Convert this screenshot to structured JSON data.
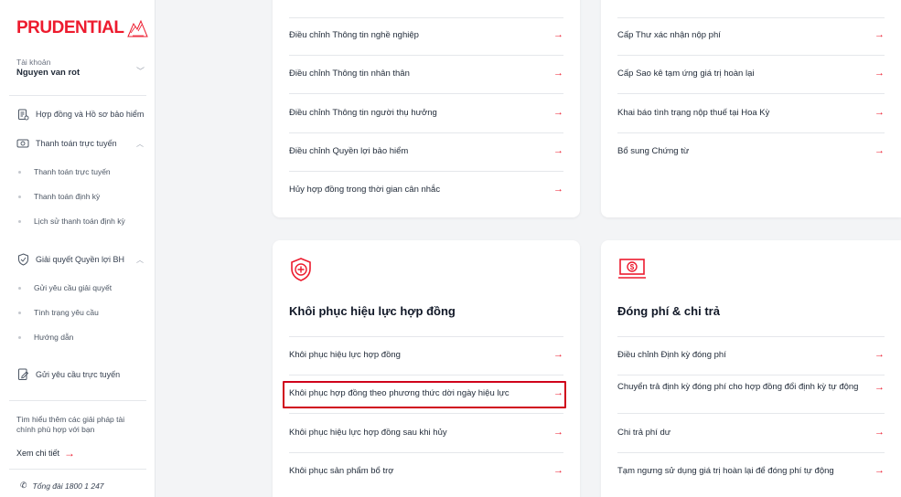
{
  "brand": {
    "logo_text": "PRUDENTIAL",
    "accent": "#ed1b2e"
  },
  "account": {
    "label": "Tài khoản",
    "name": "Nguyen van rot"
  },
  "nav": {
    "contracts": "Hợp đồng và Hồ sơ bảo hiểm",
    "online_payment": "Thanh toán trực tuyến",
    "online_payment_sub": [
      "Thanh toán trực tuyến",
      "Thanh toán định kỳ",
      "Lịch sử thanh toán định kỳ"
    ],
    "claims": "Giải quyết Quyền lợi BH",
    "claims_sub": [
      "Gửi yêu cầu giải quyết",
      "Tình trạng yêu cầu",
      "Hướng dẫn"
    ],
    "online_request": "Gửi yêu cầu trực tuyến"
  },
  "promo": {
    "text": "Tìm hiểu thêm các giải pháp tài chính phù hợp với bạn",
    "more": "Xem chi tiết"
  },
  "hotline": "Tổng đài 1800 1 247",
  "card_top_left": {
    "items": [
      "Điều chỉnh Thông tin nghề nghiệp",
      "Điều chỉnh Thông tin nhân thân",
      "Điều chỉnh Thông tin người thụ hưởng",
      "Điều chỉnh Quyền lợi bảo hiểm",
      "Hủy hợp đồng trong thời gian cân nhắc"
    ]
  },
  "card_top_right": {
    "items": [
      "Cấp Thư xác nhận nộp phí",
      "Cấp Sao kê tạm ứng giá trị hoàn lại",
      "Khai báo tình trạng nộp thuế tại Hoa Kỳ",
      "Bổ sung Chứng từ"
    ]
  },
  "card_reinstate": {
    "title": "Khôi phục hiệu lực hợp đồng",
    "icon": "shield-plus-icon",
    "items": [
      "Khôi phục hiệu lực hợp đồng",
      "Khôi phục hợp đồng theo phương thức dời ngày hiệu lực",
      "Khôi phục hiệu lực hợp đồng sau khi hủy",
      "Khôi phục sản phẩm bổ trợ"
    ]
  },
  "card_payment": {
    "title": "Đóng phí & chi trả",
    "icon": "money-icon",
    "items": [
      "Điều chỉnh Định kỳ đóng phí",
      "Chuyển trả định kỳ đóng phí cho hợp đồng đổi định kỳ tự động",
      "Chi trả phí dư",
      "Tạm ngưng sử dụng giá trị hoàn lại để đóng phí tự động"
    ]
  },
  "arrow": "→"
}
